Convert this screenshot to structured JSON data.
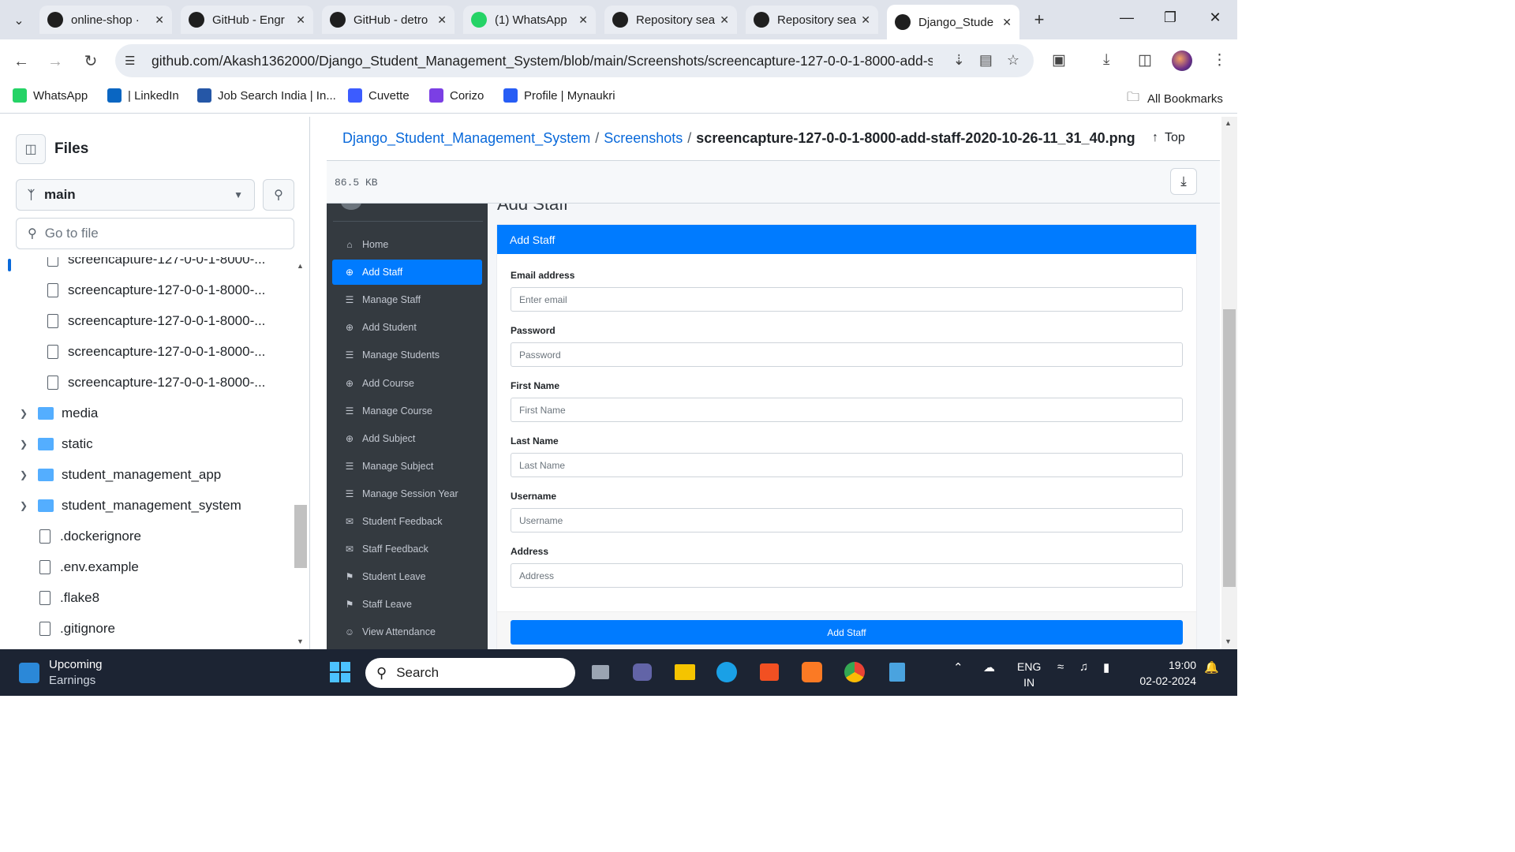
{
  "browser": {
    "tabs": [
      {
        "label": "online-shop · ",
        "icon": "github-icon"
      },
      {
        "label": "GitHub - Engr",
        "icon": "github-icon"
      },
      {
        "label": "GitHub - detro",
        "icon": "github-icon"
      },
      {
        "label": "(1) WhatsApp",
        "icon": "whatsapp-icon"
      },
      {
        "label": "Repository sea",
        "icon": "github-icon"
      },
      {
        "label": "Repository sea",
        "icon": "github-icon"
      },
      {
        "label": "Django_Stude",
        "icon": "github-icon",
        "active": true
      }
    ],
    "url": "github.com/Akash1362000/Django_Student_Management_System/blob/main/Screenshots/screencapture-127-0-0-1-8000-add-st...",
    "bookmarks": [
      {
        "label": "WhatsApp",
        "color": "#25d366"
      },
      {
        "label": "| LinkedIn",
        "color": "#0a66c2"
      },
      {
        "label": "Job Search India | In...",
        "color": "#2557a7"
      },
      {
        "label": "Cuvette",
        "color": "#3c5cff"
      },
      {
        "label": "Corizo",
        "color": "#7b3fe4"
      },
      {
        "label": "Profile | Mynaukri",
        "color": "#275df5"
      }
    ],
    "all_bookmarks": "All Bookmarks"
  },
  "sidebar": {
    "title": "Files",
    "branch": "main",
    "goto_placeholder": "Go to file",
    "tree": [
      {
        "label": "screencapture-127-0-0-1-8000-...",
        "type": "file",
        "indent": 2
      },
      {
        "label": "screencapture-127-0-0-1-8000-...",
        "type": "file",
        "indent": 2
      },
      {
        "label": "screencapture-127-0-0-1-8000-...",
        "type": "file",
        "indent": 2
      },
      {
        "label": "screencapture-127-0-0-1-8000-...",
        "type": "file",
        "indent": 2
      },
      {
        "label": "screencapture-127-0-0-1-8000-...",
        "type": "file",
        "indent": 2
      },
      {
        "label": "media",
        "type": "folder",
        "indent": 1
      },
      {
        "label": "static",
        "type": "folder",
        "indent": 1
      },
      {
        "label": "student_management_app",
        "type": "folder",
        "indent": 1
      },
      {
        "label": "student_management_system",
        "type": "folder",
        "indent": 1
      },
      {
        "label": ".dockerignore",
        "type": "file",
        "indent": 1
      },
      {
        "label": ".env.example",
        "type": "file",
        "indent": 1
      },
      {
        "label": ".flake8",
        "type": "file",
        "indent": 1
      },
      {
        "label": ".gitignore",
        "type": "file",
        "indent": 1
      }
    ]
  },
  "breadcrumb": {
    "repo": "Django_Student_Management_System",
    "folder": "Screenshots",
    "file": "screencapture-127-0-0-1-8000-add-staff-2020-10-26-11_31_40.png",
    "top": "Top"
  },
  "file": {
    "size": "86.5 KB"
  },
  "screenshot": {
    "title_fragment": "Add Staff",
    "nav": [
      {
        "label": "Home",
        "icon": "home-icon"
      },
      {
        "label": "Add Staff",
        "icon": "plus-circle-icon",
        "active": true
      },
      {
        "label": "Manage Staff",
        "icon": "list-icon"
      },
      {
        "label": "Add Student",
        "icon": "plus-circle-icon"
      },
      {
        "label": "Manage Students",
        "icon": "list-icon"
      },
      {
        "label": "Add Course",
        "icon": "plus-circle-icon"
      },
      {
        "label": "Manage Course",
        "icon": "list-icon"
      },
      {
        "label": "Add Subject",
        "icon": "plus-circle-icon"
      },
      {
        "label": "Manage Subject",
        "icon": "list-icon"
      },
      {
        "label": "Manage Session Year",
        "icon": "list-icon"
      },
      {
        "label": "Student Feedback",
        "icon": "comments-icon"
      },
      {
        "label": "Staff Feedback",
        "icon": "comments-icon"
      },
      {
        "label": "Student Leave",
        "icon": "leave-icon"
      },
      {
        "label": "Staff Leave",
        "icon": "leave-icon"
      },
      {
        "label": "View Attendance",
        "icon": "users-icon"
      }
    ],
    "card_title": "Add Staff",
    "fields": [
      {
        "label": "Email address",
        "placeholder": "Enter email"
      },
      {
        "label": "Password",
        "placeholder": "Password"
      },
      {
        "label": "First Name",
        "placeholder": "First Name"
      },
      {
        "label": "Last Name",
        "placeholder": "Last Name"
      },
      {
        "label": "Username",
        "placeholder": "Username"
      },
      {
        "label": "Address",
        "placeholder": "Address"
      }
    ],
    "submit": "Add Staff",
    "accent": "#007bff"
  },
  "taskbar": {
    "weather_line1": "Upcoming",
    "weather_line2": "Earnings",
    "search": "Search",
    "lang1": "ENG",
    "lang2": "IN",
    "time": "19:00",
    "date": "02-02-2024"
  }
}
